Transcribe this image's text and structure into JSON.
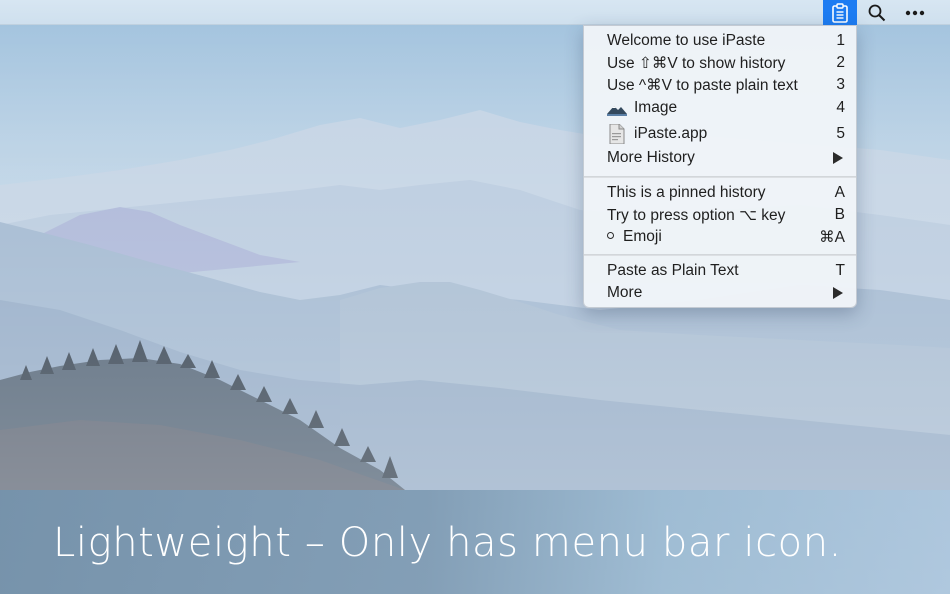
{
  "menubar": {
    "items": [
      {
        "icon": "clipboard-icon",
        "active": true
      },
      {
        "icon": "search-icon"
      },
      {
        "icon": "more-icon"
      }
    ],
    "accent_color": "#1d7cf2"
  },
  "menu": {
    "history": [
      {
        "label": "Welcome to use iPaste",
        "key": "1"
      },
      {
        "label": "Use ⇧⌘V to show history",
        "key": "2"
      },
      {
        "label": "Use ^⌘V to paste plain text",
        "key": "3"
      },
      {
        "label": "Image",
        "key": "4",
        "icon": "image-icon"
      },
      {
        "label": "iPaste.app",
        "key": "5",
        "icon": "app-file-icon"
      }
    ],
    "more_history": "More History",
    "pinned": [
      {
        "label": "This is a pinned history",
        "key": "A"
      },
      {
        "label": "Try to press option ⌥ key",
        "key": "B"
      },
      {
        "label": "Emoji",
        "key": "⌘A"
      }
    ],
    "actions": {
      "paste_plain": {
        "label": "Paste as Plain Text",
        "key": "T"
      },
      "more": "More"
    }
  },
  "caption": "Lightweight – Only has menu bar icon."
}
